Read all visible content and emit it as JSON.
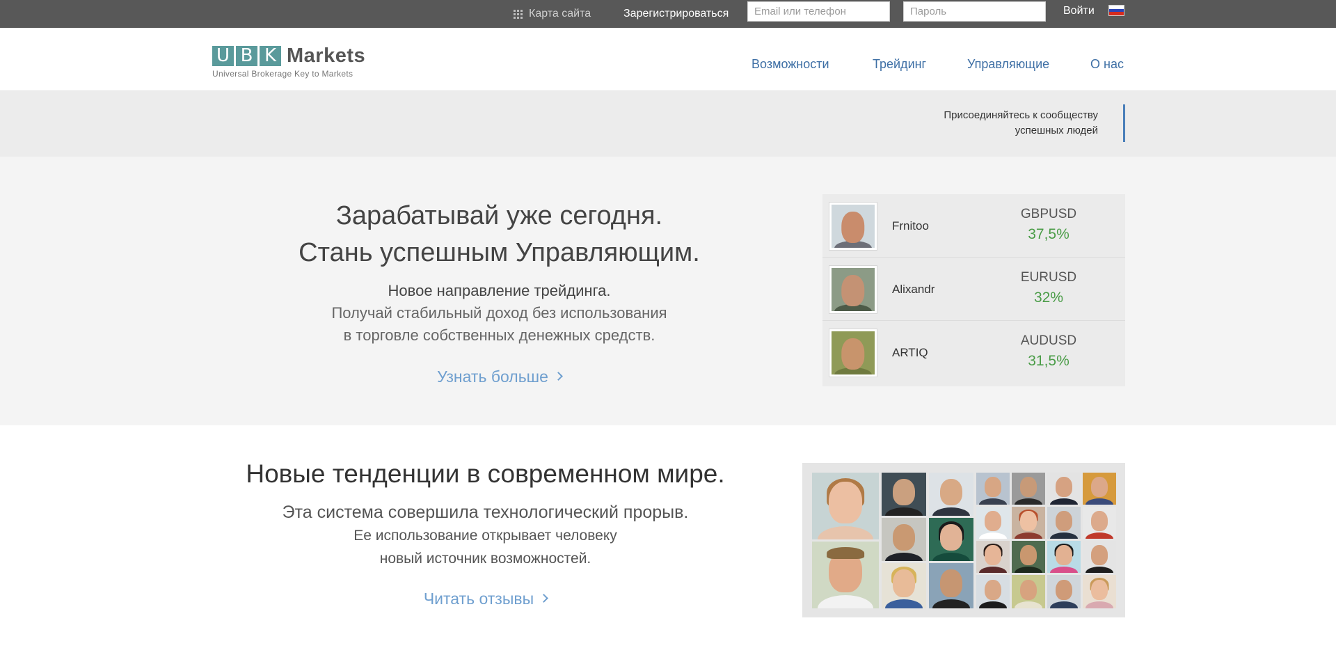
{
  "topbar": {
    "sitemap_label": "Карта сайта",
    "register_label": "Зарегистрироваться",
    "email_placeholder": "Email или телефон",
    "password_placeholder": "Пароль",
    "login_label": "Войти"
  },
  "logo": {
    "letters": [
      "U",
      "B",
      "K"
    ],
    "word": "Markets",
    "tagline": "Universal Brokerage Key to Markets"
  },
  "nav": [
    {
      "label": "Возможности"
    },
    {
      "label": "Трейдинг"
    },
    {
      "label": "Управляющие"
    },
    {
      "label": "О нас"
    }
  ],
  "join": {
    "line1": "Присоединяйтесь к сообществу",
    "line2": "успешных людей"
  },
  "hero": {
    "title_line1": "Зарабатывай уже сегодня.",
    "title_line2": "Стань успешным Управляющим.",
    "subtitle": "Новое направление трейдинга.",
    "text_line1": "Получай стабильный доход без использования",
    "text_line2": "в торговле собственных денежных средств.",
    "more_label": "Узнать больше"
  },
  "traders": [
    {
      "name": "Frnitoo",
      "pair": "GBPUSD",
      "percent": "37,5%"
    },
    {
      "name": "Alixandr",
      "pair": "EURUSD",
      "percent": "32%"
    },
    {
      "name": "ARTIQ",
      "pair": "AUDUSD",
      "percent": "31,5%"
    }
  ],
  "trends": {
    "title": "Новые тенденции в современном мире.",
    "subtitle": "Эта система совершила технологический прорыв.",
    "text_line1": "Ее использование открывает человеку",
    "text_line2": "новый источник возможностей.",
    "reviews_label": "Читать отзывы"
  },
  "colors": {
    "topbar_bg": "#585858",
    "logo_box": "#5a9a9b",
    "nav_link": "#3e6fa5",
    "accent_link": "#6f9fcf",
    "percent_green": "#4a9c47",
    "join_bar": "#4a7fb9"
  }
}
